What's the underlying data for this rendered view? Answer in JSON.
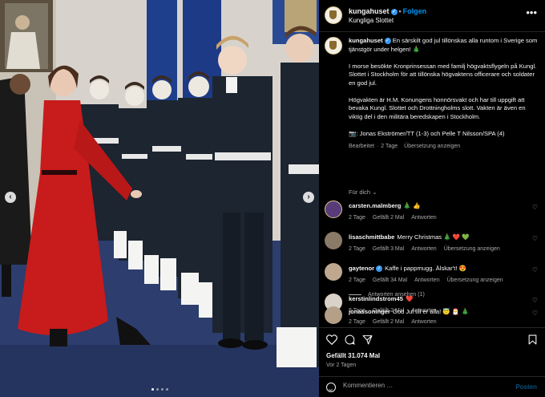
{
  "post": {
    "username": "kungahuset",
    "follow_label": "Folgen",
    "location": "Kungliga Slottet",
    "caption": {
      "username": "kungahuset",
      "paragraphs": [
        "En särskilt god jul tillönskas alla runtom i Sverige som tjänstgör under helgen! 🎄",
        "I morse besökte Kronprinsessan med familj högvaktsflygeln på Kungl. Slottet i Stockholm för att tillönska högvaktens officerare och soldater en god jul.",
        "Högvakten är H.M. Konungens honnörsvakt och har till uppgift att bevaka Kungl. Slottet och Drottningholms slott. Vakten är även en viktig del i den militära beredskapen i Stockholm.",
        "📷: Jonas Ekströmer/TT (1-3) och Pelle T Nilsson/SPA (4)"
      ],
      "edited": "Bearbeitet",
      "age": "2 Tage",
      "translate": "Übersetzung anzeigen"
    },
    "more_posts_label": "Für dich",
    "comments": [
      {
        "username": "carsten.malmberg",
        "text": "🎄 👍",
        "age": "2 Tage",
        "likes": "Gefällt 2 Mal",
        "reply": "Antworten",
        "translate": ""
      },
      {
        "username": "lisaschmittbabe",
        "text": "Merry Christmas 🎄 ❤️ 💚",
        "age": "2 Tage",
        "likes": "Gefällt 3 Mal",
        "reply": "Antworten",
        "translate": "Übersetzung anzeigen"
      },
      {
        "username": "gaytenor",
        "text": "Kaffe i pappmugg. Älskar't! 😍",
        "age": "2 Tage",
        "likes": "Gefällt 34 Mal",
        "reply": "Antworten",
        "translate": "Übersetzung anzeigen"
      },
      {
        "username": "kerstinlindstrom45",
        "text": "❤️",
        "age": "2 Tage",
        "likes": "Gefällt 2 Mal",
        "reply": "Antworten",
        "translate": ""
      },
      {
        "username": "jonassoninger",
        "text": "God Jul till er alla! 😇 🎅 🎄",
        "age": "2 Tage",
        "likes": "Gefällt 2 Mal",
        "reply": "Antworten",
        "translate": ""
      }
    ],
    "view_replies": "Antworten ansehen (1)",
    "like_count": "Gefällt 31.074 Mal",
    "date": "Vor 2 Tagen",
    "comment_placeholder": "Kommentieren …",
    "post_label": "Posten",
    "carousel": {
      "slides": 4,
      "active": 1
    }
  },
  "colors": {
    "accent": "#0095f6",
    "red_dress": "#c81b1b",
    "uniform": "#1c2530",
    "carpet": "#2c3d6e"
  },
  "icons": [
    "verified-icon",
    "more-options-icon",
    "heart-icon",
    "comment-icon",
    "share-icon",
    "bookmark-icon",
    "emoji-icon",
    "chevron-left-icon",
    "chevron-right-icon"
  ]
}
